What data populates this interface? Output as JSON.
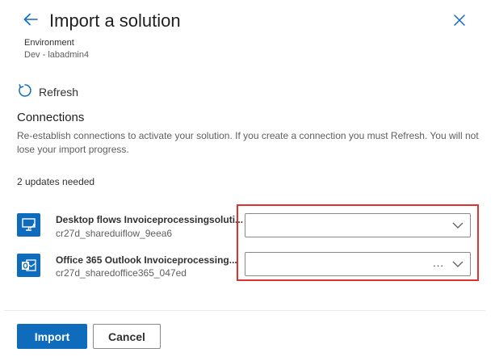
{
  "header": {
    "title": "Import a solution",
    "back_icon": "arrow-left-icon",
    "close_icon": "close-icon"
  },
  "environment": {
    "label": "Environment",
    "value": "Dev - labadmin4"
  },
  "refresh": {
    "label": "Refresh",
    "icon": "refresh-icon"
  },
  "connections": {
    "title": "Connections",
    "description": "Re-establish connections to activate your solution. If you create a connection you must Refresh. You will not lose your import progress.",
    "updates_needed": "2 updates needed",
    "items": [
      {
        "name": "Desktop flows Invoiceprocessingsoluti...",
        "id": "cr27d_shareduiflow_9eea6",
        "icon": "desktop-flows-icon",
        "selected_value": ""
      },
      {
        "name": "Office 365 Outlook Invoiceprocessing...",
        "id": "cr27d_sharedoffice365_047ed",
        "icon": "office365-outlook-icon",
        "selected_value": "..."
      }
    ]
  },
  "footer": {
    "import_label": "Import",
    "cancel_label": "Cancel"
  },
  "colors": {
    "primary": "#0f6cbd",
    "highlight": "#e03131",
    "icon_bg": "#0f6cbd"
  }
}
